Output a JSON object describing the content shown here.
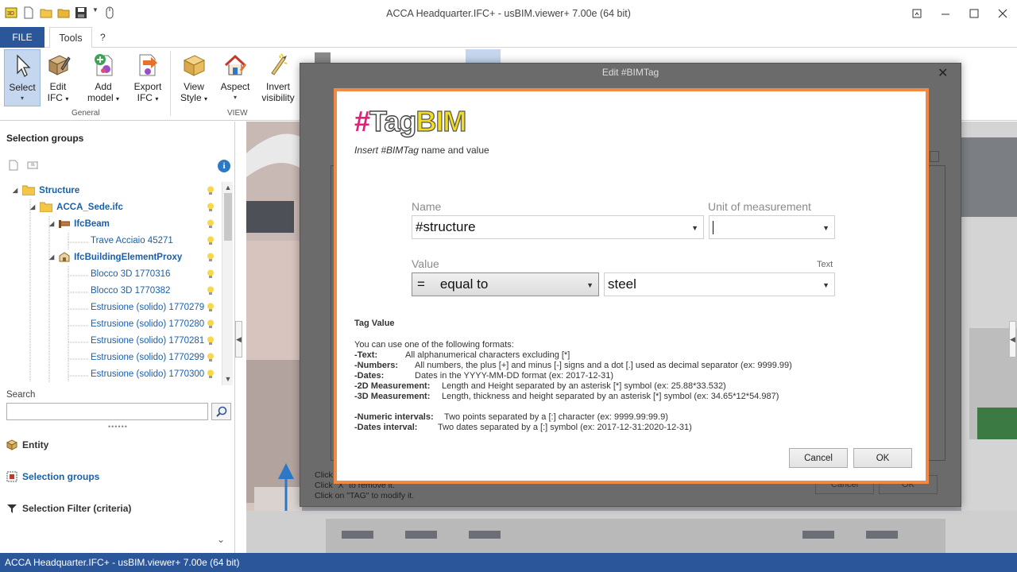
{
  "window": {
    "title": "ACCA Headquarter.IFC+ - usBIM.viewer+  7.00e (64 bit)",
    "controls": [
      "restore-icon",
      "minimize-icon",
      "maximize-icon",
      "close-icon"
    ]
  },
  "ribbon_tabs": {
    "file": "FILE",
    "tools": "Tools",
    "help": "?"
  },
  "ribbon": {
    "select": "Select",
    "edit_ifc_1": "Edit",
    "edit_ifc_2": "IFC",
    "add_model_1": "Add",
    "add_model_2": "model",
    "export_ifc_1": "Export",
    "export_ifc_2": "IFC",
    "view_style_1": "View",
    "view_style_2": "Style",
    "aspect": "Aspect",
    "invert_1": "Invert",
    "invert_2": "visibility",
    "group_general": "General",
    "group_view": "VIEW"
  },
  "left_panel": {
    "title": "Selection groups",
    "tree": [
      {
        "label": "Structure",
        "level": 0,
        "bold": true
      },
      {
        "label": "ACCA_Sede.ifc",
        "level": 1,
        "bold": true
      },
      {
        "label": "IfcBeam",
        "level": 2,
        "bold": true
      },
      {
        "label": "Trave Acciaio 45271",
        "level": 3,
        "bold": false
      },
      {
        "label": "IfcBuildingElementProxy",
        "level": 2,
        "bold": true
      },
      {
        "label": "Blocco 3D 1770316",
        "level": 3,
        "bold": false
      },
      {
        "label": "Blocco 3D 1770382",
        "level": 3,
        "bold": false
      },
      {
        "label": "Estrusione (solido) 1770279",
        "level": 3,
        "bold": false
      },
      {
        "label": "Estrusione (solido) 1770280",
        "level": 3,
        "bold": false
      },
      {
        "label": "Estrusione (solido) 1770281",
        "level": 3,
        "bold": false
      },
      {
        "label": "Estrusione (solido) 1770299",
        "level": 3,
        "bold": false
      },
      {
        "label": "Estrusione (solido) 1770300",
        "level": 3,
        "bold": false
      }
    ],
    "search_label": "Search",
    "search_value": "",
    "sections": {
      "entity": "Entity",
      "selection_groups": "Selection groups",
      "selection_filter": "Selection Filter (criteria)"
    }
  },
  "status_bar": "ACCA Headquarter.IFC+ - usBIM.viewer+  7.00e (64 bit)",
  "outer_dialog": {
    "title": "Edit #BIMTag",
    "hint_1": "Click",
    "hint_2": "Click \"X\" to remove it.",
    "hint_3": "Click on \"TAG\" to modify it.",
    "cancel": "Cancel",
    "ok": "OK"
  },
  "inner_dialog": {
    "logo_hash": "#",
    "logo_tag": "Tag",
    "logo_bim": "BIM",
    "subtitle_italic": "Insert #BIMTag",
    "subtitle_rest": " name and value",
    "name_label": "Name",
    "name_value": "#structure",
    "unit_label": "Unit of measurement",
    "unit_value": "",
    "value_label": "Value",
    "value_type": "Text",
    "operator": "=    equal to",
    "value": "steel",
    "tag_value_title": "Tag Value",
    "formats_intro": "You can use one of the following formats:",
    "formats": [
      {
        "name": "-Text:",
        "desc": "All alphanumerical characters excluding [*]"
      },
      {
        "name": "-Numbers:",
        "desc": "All numbers, the plus [+] and minus [-] signs and a dot [.] used as decimal separator (ex: 9999.99)"
      },
      {
        "name": "-Dates:",
        "desc": "Dates in the YYYY-MM-DD format (ex: 2017-12-31)"
      },
      {
        "name": "-2D Measurement:",
        "desc": "Length and Height separated by an asterisk [*] symbol (ex: 25.88*33.532)"
      },
      {
        "name": "-3D Measurement:",
        "desc": "Length, thickness and height separated by an asterisk [*] symbol (ex: 34.65*12*54.987)"
      },
      {
        "name": "-Numeric intervals:",
        "desc": "Two points separated by a [:] character (ex: 9999.99:99.9)"
      },
      {
        "name": "-Dates interval:",
        "desc": "Two dates separated by a [:] symbol (ex: 2017-12-31:2020-12-31)"
      }
    ],
    "cancel": "Cancel",
    "ok": "OK"
  },
  "colors": {
    "accent_blue": "#2b579a",
    "dialog_border": "#f08a45",
    "tree_text": "#1a5fa8"
  }
}
